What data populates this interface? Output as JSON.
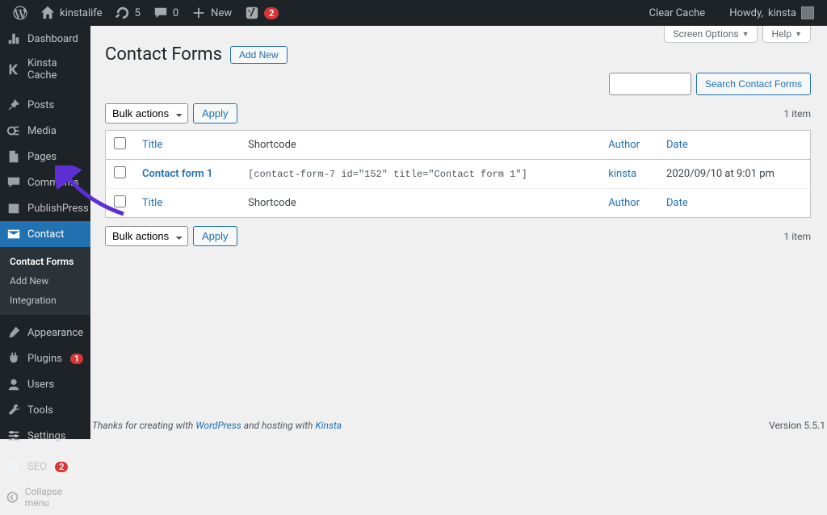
{
  "adminbar": {
    "site_name": "kinstalife",
    "updates_count": "5",
    "comments_count": "0",
    "new_label": "New",
    "notif_count": "2",
    "clear_cache": "Clear Cache",
    "howdy_prefix": "Howdy, ",
    "user": "kinsta"
  },
  "sidebar": {
    "items": [
      {
        "label": "Dashboard"
      },
      {
        "label": "Kinsta Cache"
      },
      {
        "label": "Posts"
      },
      {
        "label": "Media"
      },
      {
        "label": "Pages"
      },
      {
        "label": "Comments"
      },
      {
        "label": "PublishPress"
      },
      {
        "label": "Contact"
      },
      {
        "label": "Appearance"
      },
      {
        "label": "Plugins",
        "upd": "1"
      },
      {
        "label": "Users"
      },
      {
        "label": "Tools"
      },
      {
        "label": "Settings"
      },
      {
        "label": "SEO",
        "upd": "2"
      }
    ],
    "submenu": [
      {
        "label": "Contact Forms"
      },
      {
        "label": "Add New"
      },
      {
        "label": "Integration"
      }
    ],
    "collapse": "Collapse menu"
  },
  "screen_tabs": {
    "options": "Screen Options",
    "help": "Help"
  },
  "page": {
    "title": "Contact Forms",
    "add_new": "Add New"
  },
  "search": {
    "placeholder": "",
    "button": "Search Contact Forms"
  },
  "bulk": {
    "label": "Bulk actions",
    "apply": "Apply"
  },
  "count": "1 item",
  "cols": {
    "title": "Title",
    "shortcode": "Shortcode",
    "author": "Author",
    "date": "Date"
  },
  "rows": [
    {
      "title": "Contact form 1",
      "shortcode": "[contact-form-7 id=\"152\" title=\"Contact form 1\"]",
      "author": "kinsta",
      "date": "2020/09/10 at 9:01 pm"
    }
  ],
  "footer": {
    "thanks_pre": "Thanks for creating with ",
    "wp": "WordPress",
    "mid": " and hosting with ",
    "kinsta": "Kinsta",
    "version": "Version 5.5.1"
  }
}
